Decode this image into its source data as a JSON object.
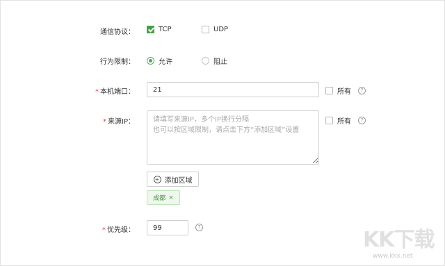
{
  "protocol": {
    "label": "通信协议：",
    "options": [
      {
        "label": "TCP",
        "checked": true
      },
      {
        "label": "UDP",
        "checked": false
      }
    ]
  },
  "behavior": {
    "label": "行为限制：",
    "options": [
      {
        "label": "允许",
        "selected": true
      },
      {
        "label": "阻止",
        "selected": false
      }
    ]
  },
  "local_port": {
    "required_mark": "*",
    "label": "本机端口：",
    "value": "21",
    "all_label": "所有",
    "all_checked": false
  },
  "source_ip": {
    "required_mark": "*",
    "label": "来源IP：",
    "placeholder": "请填写来源IP，多个IP换行分隔\n也可以按区域限制，请点击下方“添加区域”设置",
    "value": "",
    "all_label": "所有",
    "all_checked": false
  },
  "add_region": {
    "label": "添加区域",
    "icon": "plus-circle-icon"
  },
  "region_tags": [
    {
      "label": "成都",
      "remove": "×"
    }
  ],
  "priority": {
    "required_mark": "*",
    "label": "优先级：",
    "value": "99"
  },
  "help_glyph": "?",
  "watermark": {
    "logo_text": "KK下载",
    "url": "www.kkx.net"
  },
  "colors": {
    "accent_green": "#43a047",
    "required_red": "#e23b3b",
    "tag_bg": "#eef8ec"
  }
}
